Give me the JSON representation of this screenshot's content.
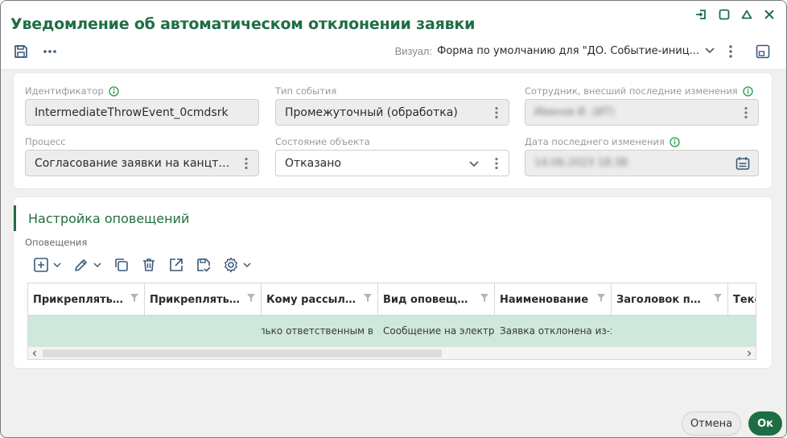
{
  "window": {
    "title": "Уведомление об автоматическом отклонении заявки"
  },
  "toolbar": {
    "visual_label": "Визуал:",
    "visual_value": "Форма по умолчанию для \"ДО. Событие-иниц..."
  },
  "fields": {
    "identifier": {
      "label": "Идентификатор",
      "value": "IntermediateThrowEvent_0cmdsrk"
    },
    "event_type": {
      "label": "Тип события",
      "value": "Промежуточный (обработка)"
    },
    "last_editor": {
      "label": "Сотрудник, внесший последние изменения",
      "value": "Иванов И. (ИТ)"
    },
    "process": {
      "label": "Процесс",
      "value": "Согласование заявки на канцтова..."
    },
    "object_state": {
      "label": "Состояние объекта",
      "value": "Отказано"
    },
    "last_change_date": {
      "label": "Дата последнего изменения",
      "value": "14.06.2023 18:38"
    }
  },
  "notifications": {
    "section_title": "Настройка оповещений",
    "grid_label": "Оповещения",
    "columns": [
      "Прикреплять ...",
      "Прикреплять ...",
      "Кому рассыла...",
      "Вид оповеще...",
      "Наименование",
      "Заголовок пи...",
      "Текст"
    ],
    "rows": [
      [
        "",
        "",
        "Только ответственным в",
        "Сообщение на электрон",
        "Заявка отклонена из-за",
        "",
        ""
      ]
    ]
  },
  "footer": {
    "cancel_label": "Отмена",
    "ok_label": "Ок"
  },
  "colors": {
    "accent": "#1f6e43",
    "row_selected": "#cfe8dc"
  }
}
